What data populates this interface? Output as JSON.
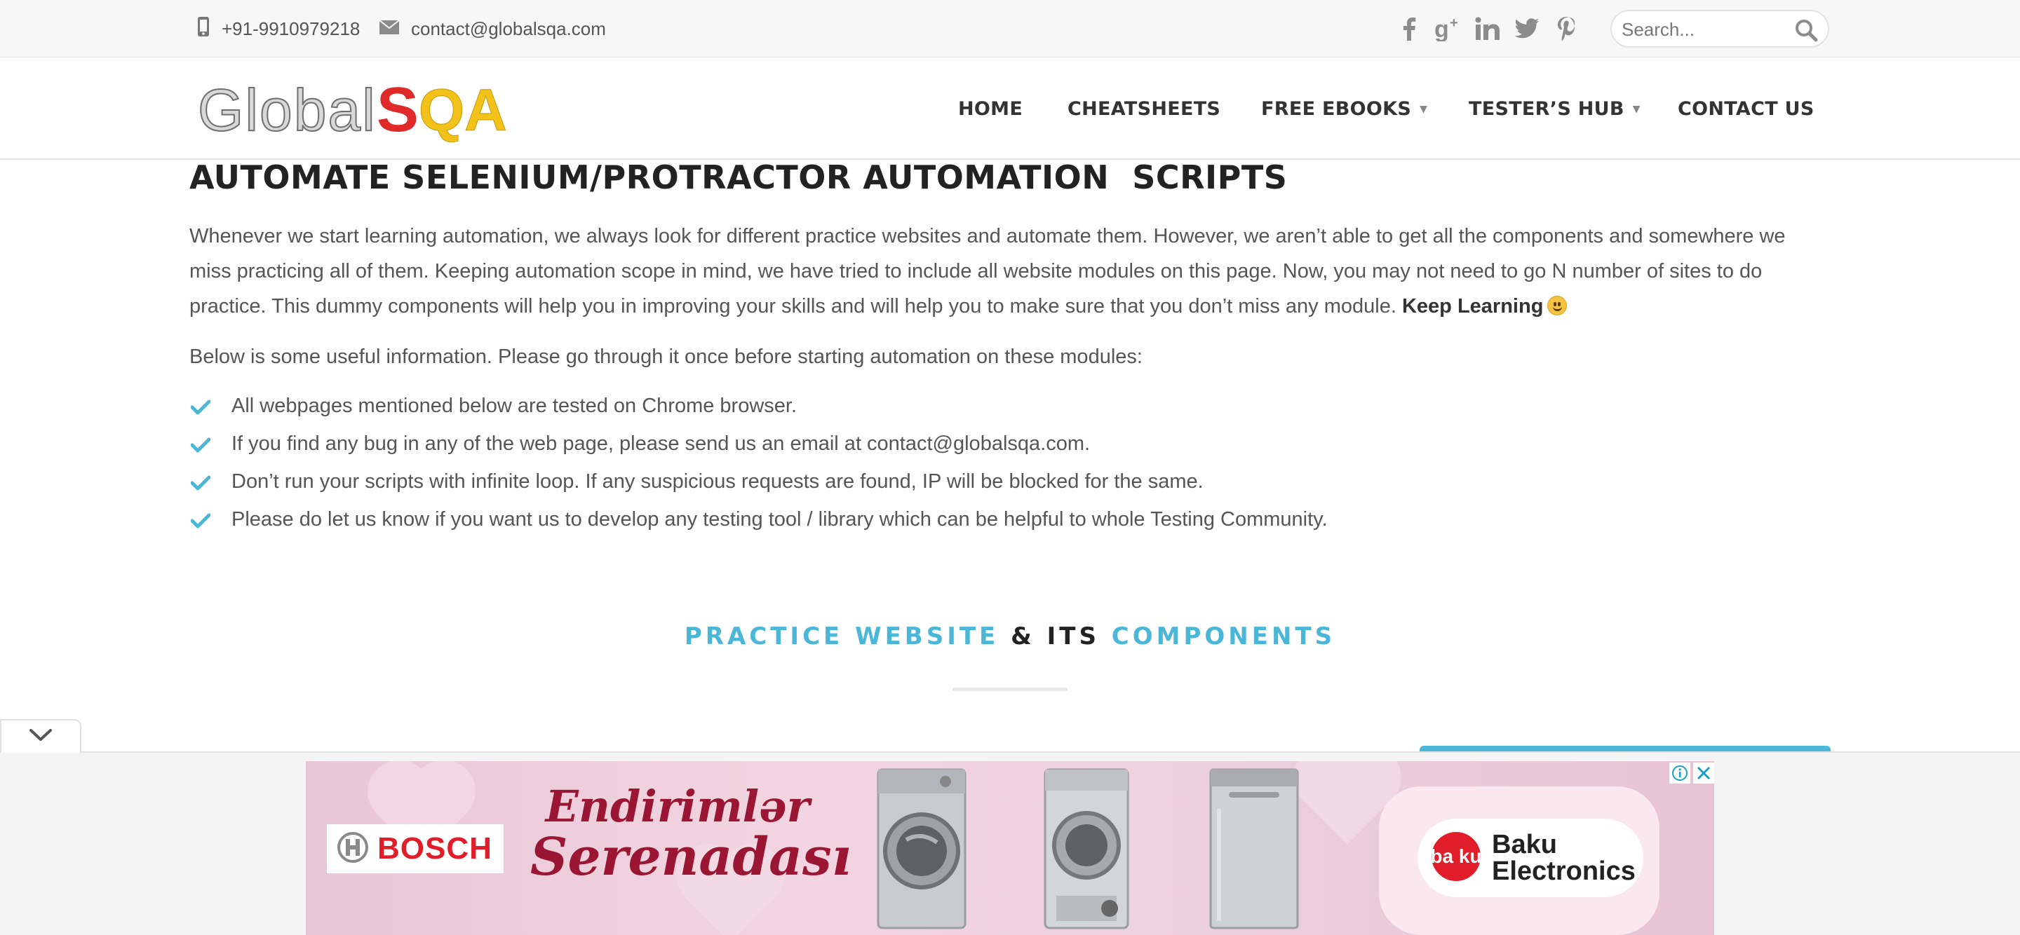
{
  "topbar": {
    "phone": "+91-9910979218",
    "email": "contact@globalsqa.com",
    "social_icons": [
      "facebook-icon",
      "google-plus-icon",
      "linkedin-icon",
      "twitter-icon",
      "pinterest-icon"
    ],
    "search_placeholder": "Search..."
  },
  "logo": {
    "part1": "Global",
    "part2": "S",
    "part3": "QA"
  },
  "nav": {
    "items": [
      {
        "label": "HOME",
        "has_dropdown": false
      },
      {
        "label": "CHEATSHEETS",
        "has_dropdown": false
      },
      {
        "label": "FREE EBOOKS",
        "has_dropdown": true
      },
      {
        "label": "TESTER’S HUB",
        "has_dropdown": true
      },
      {
        "label": "CONTACT US",
        "has_dropdown": false
      }
    ]
  },
  "content": {
    "title": "AUTOMATE SELENIUM/PROTRACTOR AUTOMATION  SCRIPTS",
    "intro": "Whenever we start learning automation, we always look for different practice websites and automate them. However, we aren’t able to get all the components and somewhere we miss practicing all of them. Keeping automation scope in mind, we have tried to include all website modules on this page. Now, you may not need to go N number of sites to do practice. This dummy components will help you in improving your skills and will help you to make sure that you don’t miss any module.",
    "intro_bold": "Keep Learning",
    "lead": "Below is some useful information. Please go through it once before starting automation on these modules:",
    "checklist": [
      "All webpages mentioned below are tested on Chrome browser.",
      "If you find any bug in any of the web page, please send us an email at contact@globalsqa.com.",
      "Don’t run your scripts with infinite loop. If any suspicious requests are found, IP will be blocked for the same.",
      "Please do let us know if you want us to develop any testing tool / library which can be helpful to whole Testing Community."
    ],
    "section_heading": {
      "part1": "PRACTICE WEBSITE",
      "part2": "& ITS",
      "part3": "COMPONENTS"
    }
  },
  "ad": {
    "brand1": "BOSCH",
    "headline_line1": "Endirimlər",
    "headline_line2": "Serenadası",
    "brand2": "Baku Electronics",
    "brand2_line1": "Baku",
    "brand2_line2": "Electronics"
  },
  "colors": {
    "accent": "#4bb7d8",
    "text": "#555555",
    "heading": "#222222",
    "topbar_bg": "#f7f7f7",
    "bosch_red": "#e11d2a",
    "ad_headline": "#9b1632"
  }
}
